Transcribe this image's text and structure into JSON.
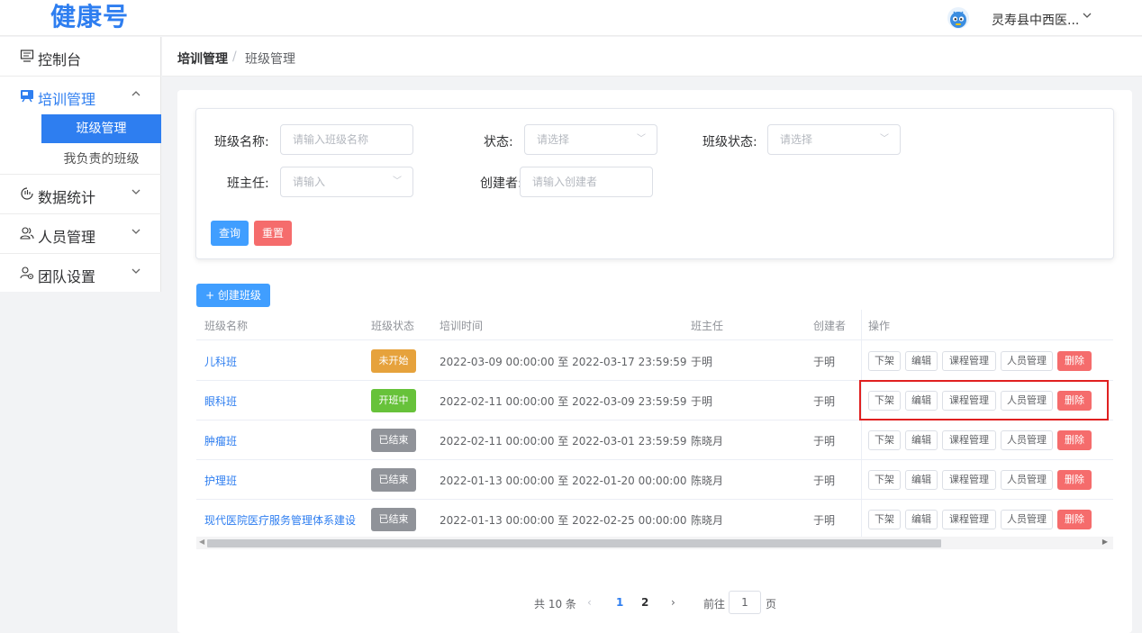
{
  "header": {
    "logo": "健康号",
    "user_name": "灵寿县中西医..."
  },
  "sidebar": {
    "items": [
      {
        "label": "控制台",
        "icon": "monitor-icon"
      },
      {
        "label": "培训管理",
        "icon": "training-icon",
        "expanded": true
      },
      {
        "label": "数据统计",
        "icon": "chart-icon"
      },
      {
        "label": "人员管理",
        "icon": "users-icon"
      },
      {
        "label": "团队设置",
        "icon": "team-icon"
      }
    ],
    "sub_items": [
      "班级管理",
      "我负责的班级"
    ]
  },
  "breadcrumb": {
    "parent": "培训管理",
    "sep": "/",
    "current": "班级管理"
  },
  "search": {
    "class_name_label": "班级名称:",
    "class_name_placeholder": "请输入班级名称",
    "status_label": "状态:",
    "status_placeholder": "请选择",
    "class_status_label": "班级状态:",
    "class_status_placeholder": "请选择",
    "teacher_label": "班主任:",
    "teacher_placeholder": "请输入",
    "creator_label": "创建者:",
    "creator_placeholder": "请输入创建者",
    "query_label": "查询",
    "reset_label": "重置"
  },
  "create_label": "+ 创建班级",
  "table": {
    "headers": [
      "班级名称",
      "班级状态",
      "培训时间",
      "班主任",
      "创建者",
      "操作"
    ],
    "op_labels": [
      "下架",
      "编辑",
      "课程管理",
      "人员管理",
      "删除"
    ],
    "rows": [
      {
        "name": "儿科班",
        "status": "未开始",
        "status_color": "#e6a23c",
        "time": "2022-03-09 00:00:00 至 2022-03-17 23:59:59",
        "teacher": "于明",
        "creator": "于明"
      },
      {
        "name": "眼科班",
        "status": "开班中",
        "status_color": "#67c23a",
        "time": "2022-02-11 00:00:00 至 2022-03-09 23:59:59",
        "teacher": "于明",
        "creator": "于明"
      },
      {
        "name": "肿瘤班",
        "status": "已结束",
        "status_color": "#909399",
        "time": "2022-02-11 00:00:00 至 2022-03-01 23:59:59",
        "teacher": "陈晓月",
        "creator": "于明"
      },
      {
        "name": "护理班",
        "status": "已结束",
        "status_color": "#909399",
        "time": "2022-01-13 00:00:00 至 2022-01-20 00:00:00",
        "teacher": "陈晓月",
        "creator": "于明"
      },
      {
        "name": "现代医院医疗服务管理体系建设",
        "status": "已结束",
        "status_color": "#909399",
        "time": "2022-01-13 00:00:00 至 2022-02-25 00:00:00",
        "teacher": "陈晓月",
        "creator": "于明"
      }
    ]
  },
  "pagination": {
    "total": "共 10 条",
    "prev": "‹",
    "page1": "1",
    "page2": "2",
    "next": "›",
    "goto_label": "前往",
    "goto_value": "1",
    "page_suffix": "页"
  }
}
